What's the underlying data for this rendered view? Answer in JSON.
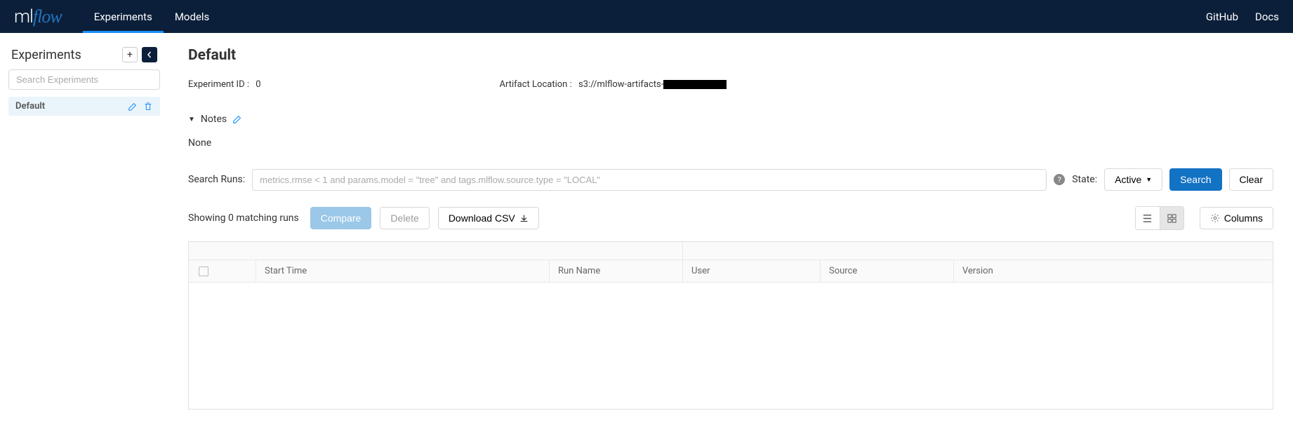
{
  "header": {
    "nav": {
      "experiments": "Experiments",
      "models": "Models"
    },
    "links": {
      "github": "GitHub",
      "docs": "Docs"
    }
  },
  "sidebar": {
    "title": "Experiments",
    "search_placeholder": "Search Experiments",
    "items": [
      {
        "name": "Default"
      }
    ]
  },
  "main": {
    "title": "Default",
    "experiment_id_label": "Experiment ID :",
    "experiment_id_value": "0",
    "artifact_location_label": "Artifact Location :",
    "artifact_location_value": "s3://mlflow-artifacts-",
    "notes": {
      "header": "Notes",
      "content": "None"
    },
    "search": {
      "label": "Search Runs:",
      "placeholder": "metrics.rmse < 1 and params.model = \"tree\" and tags.mlflow.source.type = \"LOCAL\"",
      "state_label": "State:",
      "state_value": "Active",
      "search_btn": "Search",
      "clear_btn": "Clear"
    },
    "results": {
      "text": "Showing 0 matching runs",
      "compare_btn": "Compare",
      "delete_btn": "Delete",
      "download_btn": "Download CSV",
      "columns_btn": "Columns"
    },
    "table": {
      "columns": {
        "start_time": "Start Time",
        "run_name": "Run Name",
        "user": "User",
        "source": "Source",
        "version": "Version"
      }
    }
  }
}
